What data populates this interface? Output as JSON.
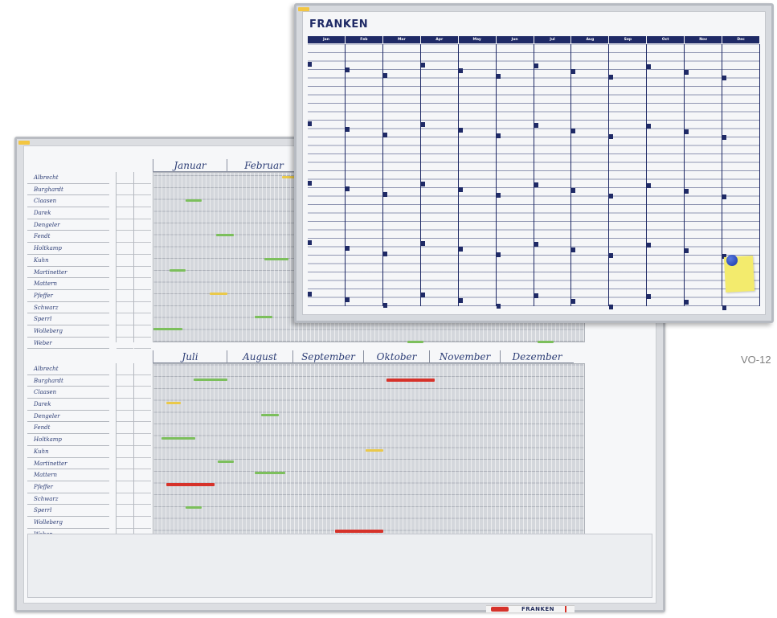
{
  "product_label": "VO-12",
  "front_board": {
    "brand": "FRANKEN",
    "months": [
      "Jan",
      "Feb",
      "Mar",
      "Apr",
      "May",
      "Jun",
      "Jul",
      "Aug",
      "Sep",
      "Oct",
      "Nov",
      "Dec"
    ]
  },
  "back_board": {
    "months_top": [
      "Januar",
      "Februar"
    ],
    "months_bottom": [
      "Juli",
      "August",
      "September",
      "Oktober",
      "November",
      "Dezember"
    ],
    "names": [
      "Albrecht",
      "Burghardt",
      "Claasen",
      "Darek",
      "Dengeler",
      "Fendt",
      "Holtkamp",
      "Kuhn",
      "Martinetter",
      "Mattern",
      "Pfeffer",
      "Schwarz",
      "Sperrl",
      "Wolleberg",
      "Weber"
    ],
    "strip_brand": "FRANKEN",
    "colors": {
      "frame": "#b9bcc2",
      "header_navy": "#1f2a66",
      "bar_green": "#7cbf5c",
      "bar_yellow": "#eac94a",
      "bar_red": "#d6322a"
    }
  }
}
